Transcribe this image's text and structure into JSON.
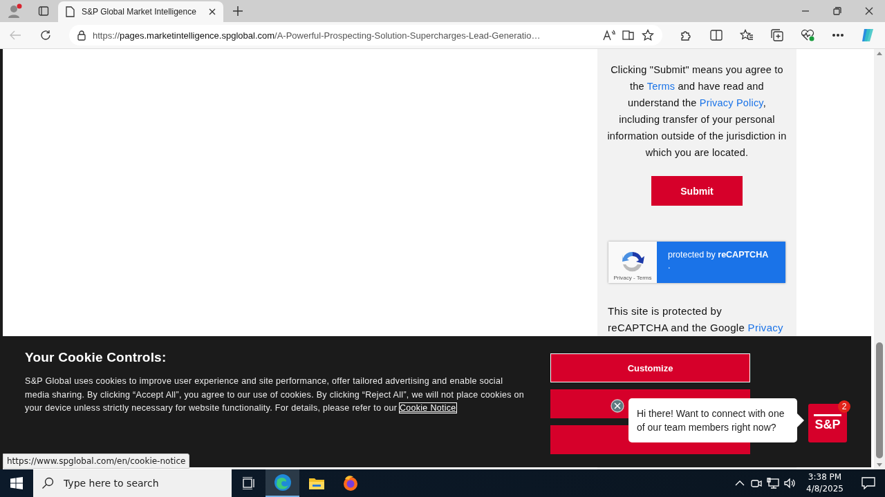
{
  "browser": {
    "tabs": [
      {
        "title": "S&P Global Market Intelligence",
        "selected": true
      }
    ],
    "address": {
      "parts": [
        "https://",
        "pages.marketintelligence.spglobal.com",
        "/A-Powerful-Prospecting-Solution-Supercharges-Lead-Generatio…"
      ]
    }
  },
  "form_panel": {
    "consent": [
      {
        "text": "Clicking \"Submit\" means you agree to the "
      },
      {
        "text": "Terms",
        "link": true
      },
      {
        "text": " and have read and understand the "
      },
      {
        "text": "Privacy Policy",
        "link": true
      },
      {
        "text": ", including transfer of your personal information outside of the jurisdiction in which you are located."
      }
    ],
    "submit": "Submit",
    "recaptcha": {
      "label": "protected by **reCAPTCHA**",
      "dot": ".",
      "links": "Privacy - Terms"
    },
    "notice": "This site is protected by",
    "notice_cut": [
      {
        "text": "reCAPTCHA and the Google "
      },
      {
        "text": "Privacy",
        "link": true
      }
    ]
  },
  "cookie_banner": {
    "title": "Your Cookie Controls:",
    "body": [
      {
        "text": "S&P Global uses cookies to improve user experience and site performance, offer tailored advertising and enable social media sharing. By clicking “Accept All”, you agree to our use of cookies. By clicking “Reject All”, we will not place cookies on your device unless strictly necessary for website functionality. For details, please refer to our "
      },
      {
        "text": "Cookie Notice",
        "link": true
      }
    ],
    "buttons": [
      {
        "label": "Customize",
        "kind": "outlined"
      },
      {
        "kind": "filled"
      },
      {
        "kind": "filled"
      }
    ]
  },
  "chat": {
    "message": "Hi there! Want to connect with one of our team members right now?",
    "launcher": "S&P",
    "badge": "2"
  },
  "status_url": "https://www.spglobal.com/en/cookie-notice",
  "taskbar": {
    "search_placeholder": "Type here to search",
    "time": "3:38 PM",
    "date": "4/8/2025"
  }
}
